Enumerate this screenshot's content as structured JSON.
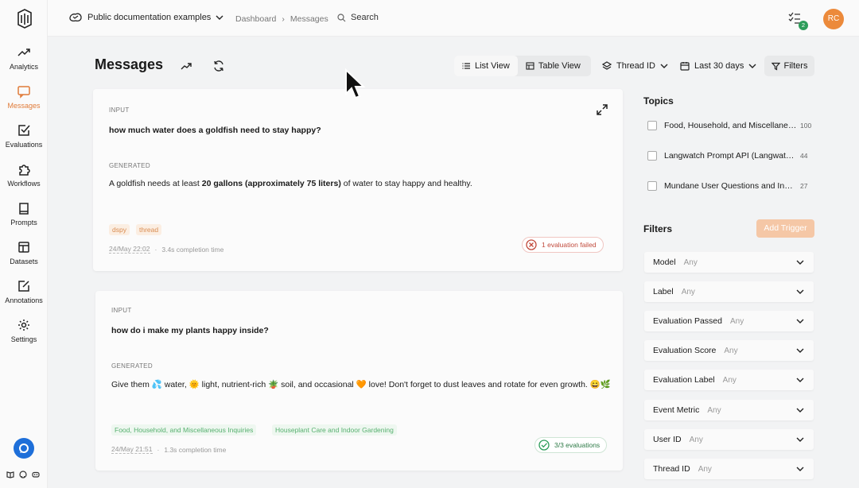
{
  "project": {
    "name": "Public documentation examples"
  },
  "breadcrumb": [
    "Dashboard",
    "Messages"
  ],
  "search": {
    "label": "Search"
  },
  "tasks": {
    "badge": "2"
  },
  "user": {
    "initials": "RC"
  },
  "nav": [
    {
      "label": "Analytics",
      "icon": "trend-up-icon"
    },
    {
      "label": "Messages",
      "icon": "message-icon",
      "active": true
    },
    {
      "label": "Evaluations",
      "icon": "check-square-icon"
    },
    {
      "label": "Workflows",
      "icon": "puzzle-icon"
    },
    {
      "label": "Prompts",
      "icon": "book-icon"
    },
    {
      "label": "Datasets",
      "icon": "table-icon"
    },
    {
      "label": "Annotations",
      "icon": "edit-icon"
    },
    {
      "label": "Settings",
      "icon": "gear-icon"
    }
  ],
  "page": {
    "title": "Messages"
  },
  "views": {
    "list": "List View",
    "table": "Table View",
    "active": "List View"
  },
  "grouping": "Thread ID",
  "date_range": "Last 30 days",
  "filters_button": "Filters",
  "messages": [
    {
      "input_label": "INPUT",
      "input": "how much water does a goldfish need to stay happy?",
      "generated_label": "GENERATED",
      "generated_pre": "A goldfish needs at least ",
      "generated_bold": "20 gallons (approximately 75 liters)",
      "generated_post": " of water to stay happy and healthy.",
      "tags": [
        "dspy",
        "thread"
      ],
      "date": "24/May 22:02",
      "completion": "3.4s completion time",
      "evaluation": "1 evaluation failed"
    },
    {
      "input_label": "INPUT",
      "input": "how do i make my plants happy inside?",
      "generated_label": "GENERATED",
      "generated": "Give them 💦 water, 🌞 light, nutrient-rich 🪴 soil, and occasional 🧡 love! Don't forget to dust leaves and rotate for even growth. 😄🌿",
      "tags": [
        "Food, Household, and Miscellaneous Inquiries",
        "Houseplant Care and Indoor Gardening"
      ],
      "date": "24/May 21:51",
      "completion": "1.3s completion time",
      "evaluation": "3/3 evaluations"
    }
  ],
  "topics": {
    "title": "Topics",
    "items": [
      {
        "name": "Food, Household, and Miscellaneous Inquiries",
        "count": "100"
      },
      {
        "name": "Langwatch Prompt API (Langwatch Prompt API)",
        "count": "44"
      },
      {
        "name": "Mundane User Questions and Inquiries",
        "count": "27"
      }
    ]
  },
  "filters": {
    "title": "Filters",
    "add_trigger": "Add Trigger",
    "any_label": "Any",
    "items": [
      "Model",
      "Label",
      "Evaluation Passed",
      "Evaluation Score",
      "Evaluation Label",
      "Event Metric",
      "User ID",
      "Thread ID"
    ]
  },
  "colors": {
    "accent": "#e07b39",
    "fail": "#c14a3c",
    "pass": "#2d9d5a"
  }
}
